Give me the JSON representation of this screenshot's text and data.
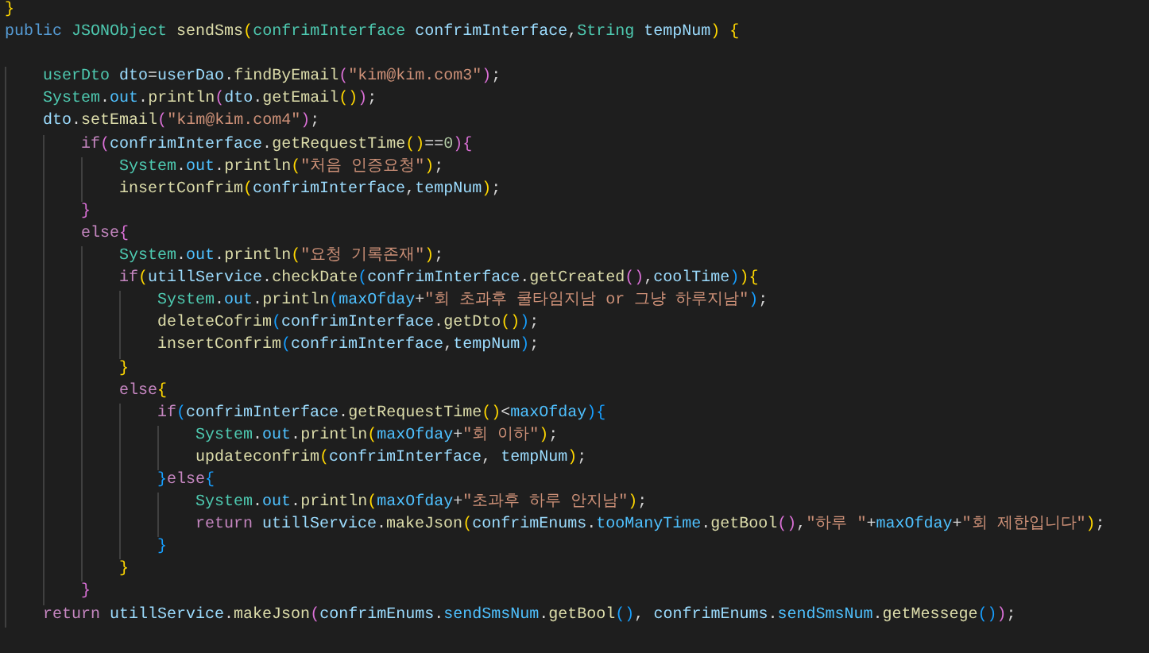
{
  "editor": {
    "lines": [
      {
        "kind": "code",
        "tokens": [
          {
            "kind": "b1",
            "text": "}"
          }
        ]
      },
      {
        "kind": "code",
        "tokens": [
          {
            "kind": "kw",
            "text": "public"
          },
          {
            "kind": "type",
            "text": " JSONObject"
          },
          {
            "kind": "fn",
            "text": " sendSms"
          },
          {
            "kind": "b1",
            "text": "("
          },
          {
            "kind": "type",
            "text": "confrimInterface"
          },
          {
            "kind": "var",
            "text": " confrimInterface"
          },
          {
            "kind": "p",
            "text": ","
          },
          {
            "kind": "type",
            "text": "String"
          },
          {
            "kind": "var",
            "text": " tempNum"
          },
          {
            "kind": "b1",
            "text": ")"
          },
          {
            "kind": "b1",
            "text": " {"
          }
        ]
      },
      {
        "kind": "blank"
      },
      {
        "kind": "code",
        "tokens": [
          {
            "kind": "type",
            "text": "    userDto"
          },
          {
            "kind": "var",
            "text": " dto"
          },
          {
            "kind": "p",
            "text": "="
          },
          {
            "kind": "var",
            "text": "userDao"
          },
          {
            "kind": "p",
            "text": "."
          },
          {
            "kind": "fn",
            "text": "findByEmail"
          },
          {
            "kind": "b2",
            "text": "("
          },
          {
            "kind": "str",
            "text": "\"kim@kim.com3\""
          },
          {
            "kind": "b2",
            "text": ")"
          },
          {
            "kind": "p",
            "text": ";"
          }
        ]
      },
      {
        "kind": "code",
        "tokens": [
          {
            "kind": "type",
            "text": "    System"
          },
          {
            "kind": "p",
            "text": "."
          },
          {
            "kind": "const",
            "text": "out"
          },
          {
            "kind": "p",
            "text": "."
          },
          {
            "kind": "fn",
            "text": "println"
          },
          {
            "kind": "b2",
            "text": "("
          },
          {
            "kind": "var",
            "text": "dto"
          },
          {
            "kind": "p",
            "text": "."
          },
          {
            "kind": "fn",
            "text": "getEmail"
          },
          {
            "kind": "b1",
            "text": "()"
          },
          {
            "kind": "b2",
            "text": ")"
          },
          {
            "kind": "p",
            "text": ";"
          }
        ]
      },
      {
        "kind": "code",
        "tokens": [
          {
            "kind": "var",
            "text": "    dto"
          },
          {
            "kind": "p",
            "text": "."
          },
          {
            "kind": "fn",
            "text": "setEmail"
          },
          {
            "kind": "b2",
            "text": "("
          },
          {
            "kind": "str",
            "text": "\"kim@kim.com4\""
          },
          {
            "kind": "b2",
            "text": ")"
          },
          {
            "kind": "p",
            "text": ";"
          }
        ]
      },
      {
        "kind": "code",
        "tokens": [
          {
            "kind": "ctl",
            "text": "        if"
          },
          {
            "kind": "b2",
            "text": "("
          },
          {
            "kind": "var",
            "text": "confrimInterface"
          },
          {
            "kind": "p",
            "text": "."
          },
          {
            "kind": "fn",
            "text": "getRequestTime"
          },
          {
            "kind": "b1",
            "text": "()"
          },
          {
            "kind": "p",
            "text": "=="
          },
          {
            "kind": "num",
            "text": "0"
          },
          {
            "kind": "b2",
            "text": ")"
          },
          {
            "kind": "b2",
            "text": "{"
          }
        ]
      },
      {
        "kind": "code",
        "tokens": [
          {
            "kind": "type",
            "text": "            System"
          },
          {
            "kind": "p",
            "text": "."
          },
          {
            "kind": "const",
            "text": "out"
          },
          {
            "kind": "p",
            "text": "."
          },
          {
            "kind": "fn",
            "text": "println"
          },
          {
            "kind": "b1",
            "text": "("
          },
          {
            "kind": "str",
            "text": "\"처음 인증요청\""
          },
          {
            "kind": "b1",
            "text": ")"
          },
          {
            "kind": "p",
            "text": ";"
          }
        ]
      },
      {
        "kind": "code",
        "tokens": [
          {
            "kind": "fn",
            "text": "            insertConfrim"
          },
          {
            "kind": "b1",
            "text": "("
          },
          {
            "kind": "var",
            "text": "confrimInterface"
          },
          {
            "kind": "p",
            "text": ","
          },
          {
            "kind": "var",
            "text": "tempNum"
          },
          {
            "kind": "b1",
            "text": ")"
          },
          {
            "kind": "p",
            "text": ";"
          }
        ]
      },
      {
        "kind": "code",
        "tokens": [
          {
            "kind": "b2",
            "text": "        }"
          }
        ]
      },
      {
        "kind": "code",
        "tokens": [
          {
            "kind": "ctl",
            "text": "        else"
          },
          {
            "kind": "b2",
            "text": "{"
          }
        ]
      },
      {
        "kind": "code",
        "tokens": [
          {
            "kind": "type",
            "text": "            System"
          },
          {
            "kind": "p",
            "text": "."
          },
          {
            "kind": "const",
            "text": "out"
          },
          {
            "kind": "p",
            "text": "."
          },
          {
            "kind": "fn",
            "text": "println"
          },
          {
            "kind": "b1",
            "text": "("
          },
          {
            "kind": "str",
            "text": "\"요청 기록존재\""
          },
          {
            "kind": "b1",
            "text": ")"
          },
          {
            "kind": "p",
            "text": ";"
          }
        ]
      },
      {
        "kind": "code",
        "tokens": [
          {
            "kind": "ctl",
            "text": "            if"
          },
          {
            "kind": "b1",
            "text": "("
          },
          {
            "kind": "var",
            "text": "utillService"
          },
          {
            "kind": "p",
            "text": "."
          },
          {
            "kind": "fn",
            "text": "checkDate"
          },
          {
            "kind": "b3",
            "text": "("
          },
          {
            "kind": "var",
            "text": "confrimInterface"
          },
          {
            "kind": "p",
            "text": "."
          },
          {
            "kind": "fn",
            "text": "getCreated"
          },
          {
            "kind": "b2",
            "text": "()"
          },
          {
            "kind": "p",
            "text": ","
          },
          {
            "kind": "var",
            "text": "coolTime"
          },
          {
            "kind": "b3",
            "text": ")"
          },
          {
            "kind": "b1",
            "text": ")"
          },
          {
            "kind": "b1",
            "text": "{"
          }
        ]
      },
      {
        "kind": "code",
        "tokens": [
          {
            "kind": "type",
            "text": "                System"
          },
          {
            "kind": "p",
            "text": "."
          },
          {
            "kind": "const",
            "text": "out"
          },
          {
            "kind": "p",
            "text": "."
          },
          {
            "kind": "fn",
            "text": "println"
          },
          {
            "kind": "b3",
            "text": "("
          },
          {
            "kind": "const",
            "text": "maxOfday"
          },
          {
            "kind": "p",
            "text": "+"
          },
          {
            "kind": "str",
            "text": "\"회 초과후 쿨타임지남 or 그냥 하루지남\""
          },
          {
            "kind": "b3",
            "text": ")"
          },
          {
            "kind": "p",
            "text": ";"
          }
        ]
      },
      {
        "kind": "code",
        "tokens": [
          {
            "kind": "fn",
            "text": "                deleteCofrim"
          },
          {
            "kind": "b3",
            "text": "("
          },
          {
            "kind": "var",
            "text": "confrimInterface"
          },
          {
            "kind": "p",
            "text": "."
          },
          {
            "kind": "fn",
            "text": "getDto"
          },
          {
            "kind": "b1",
            "text": "()"
          },
          {
            "kind": "b3",
            "text": ")"
          },
          {
            "kind": "p",
            "text": ";"
          }
        ]
      },
      {
        "kind": "code",
        "tokens": [
          {
            "kind": "fn",
            "text": "                insertConfrim"
          },
          {
            "kind": "b3",
            "text": "("
          },
          {
            "kind": "var",
            "text": "confrimInterface"
          },
          {
            "kind": "p",
            "text": ","
          },
          {
            "kind": "var",
            "text": "tempNum"
          },
          {
            "kind": "b3",
            "text": ")"
          },
          {
            "kind": "p",
            "text": ";"
          }
        ]
      },
      {
        "kind": "code",
        "tokens": [
          {
            "kind": "b1",
            "text": "            }"
          }
        ]
      },
      {
        "kind": "code",
        "tokens": [
          {
            "kind": "ctl",
            "text": "            else"
          },
          {
            "kind": "b1",
            "text": "{"
          }
        ]
      },
      {
        "kind": "code",
        "tokens": [
          {
            "kind": "ctl",
            "text": "                if"
          },
          {
            "kind": "b3",
            "text": "("
          },
          {
            "kind": "var",
            "text": "confrimInterface"
          },
          {
            "kind": "p",
            "text": "."
          },
          {
            "kind": "fn",
            "text": "getRequestTime"
          },
          {
            "kind": "b1",
            "text": "()"
          },
          {
            "kind": "p",
            "text": "<"
          },
          {
            "kind": "const",
            "text": "maxOfday"
          },
          {
            "kind": "b3",
            "text": ")"
          },
          {
            "kind": "b3",
            "text": "{"
          }
        ]
      },
      {
        "kind": "code",
        "tokens": [
          {
            "kind": "type",
            "text": "                    System"
          },
          {
            "kind": "p",
            "text": "."
          },
          {
            "kind": "const",
            "text": "out"
          },
          {
            "kind": "p",
            "text": "."
          },
          {
            "kind": "fn",
            "text": "println"
          },
          {
            "kind": "b1",
            "text": "("
          },
          {
            "kind": "const",
            "text": "maxOfday"
          },
          {
            "kind": "p",
            "text": "+"
          },
          {
            "kind": "str",
            "text": "\"회 이하\""
          },
          {
            "kind": "b1",
            "text": ")"
          },
          {
            "kind": "p",
            "text": ";"
          }
        ]
      },
      {
        "kind": "code",
        "tokens": [
          {
            "kind": "fn",
            "text": "                    updateconfrim"
          },
          {
            "kind": "b1",
            "text": "("
          },
          {
            "kind": "var",
            "text": "confrimInterface"
          },
          {
            "kind": "p",
            "text": ","
          },
          {
            "kind": "var",
            "text": " tempNum"
          },
          {
            "kind": "b1",
            "text": ")"
          },
          {
            "kind": "p",
            "text": ";"
          }
        ]
      },
      {
        "kind": "code",
        "tokens": [
          {
            "kind": "b3",
            "text": "                }"
          },
          {
            "kind": "ctl",
            "text": "else"
          },
          {
            "kind": "b3",
            "text": "{"
          }
        ]
      },
      {
        "kind": "code",
        "tokens": [
          {
            "kind": "type",
            "text": "                    System"
          },
          {
            "kind": "p",
            "text": "."
          },
          {
            "kind": "const",
            "text": "out"
          },
          {
            "kind": "p",
            "text": "."
          },
          {
            "kind": "fn",
            "text": "println"
          },
          {
            "kind": "b1",
            "text": "("
          },
          {
            "kind": "const",
            "text": "maxOfday"
          },
          {
            "kind": "p",
            "text": "+"
          },
          {
            "kind": "str",
            "text": "\"초과후 하루 안지남\""
          },
          {
            "kind": "b1",
            "text": ")"
          },
          {
            "kind": "p",
            "text": ";"
          }
        ]
      },
      {
        "kind": "code",
        "tokens": [
          {
            "kind": "ctl",
            "text": "                    return"
          },
          {
            "kind": "var",
            "text": " utillService"
          },
          {
            "kind": "p",
            "text": "."
          },
          {
            "kind": "fn",
            "text": "makeJson"
          },
          {
            "kind": "b1",
            "text": "("
          },
          {
            "kind": "var",
            "text": "confrimEnums"
          },
          {
            "kind": "p",
            "text": "."
          },
          {
            "kind": "const",
            "text": "tooManyTime"
          },
          {
            "kind": "p",
            "text": "."
          },
          {
            "kind": "fn",
            "text": "getBool"
          },
          {
            "kind": "b2",
            "text": "()"
          },
          {
            "kind": "p",
            "text": ","
          },
          {
            "kind": "str",
            "text": "\"하루 \""
          },
          {
            "kind": "p",
            "text": "+"
          },
          {
            "kind": "const",
            "text": "maxOfday"
          },
          {
            "kind": "p",
            "text": "+"
          },
          {
            "kind": "str",
            "text": "\"회 제한입니다\""
          },
          {
            "kind": "b1",
            "text": ")"
          },
          {
            "kind": "p",
            "text": ";"
          }
        ]
      },
      {
        "kind": "code",
        "tokens": [
          {
            "kind": "b3",
            "text": "                }"
          }
        ]
      },
      {
        "kind": "code",
        "tokens": [
          {
            "kind": "b1",
            "text": "            }"
          }
        ]
      },
      {
        "kind": "code",
        "tokens": [
          {
            "kind": "b2",
            "text": "        }"
          }
        ]
      },
      {
        "kind": "code",
        "tokens": [
          {
            "kind": "ctl",
            "text": "    return"
          },
          {
            "kind": "var",
            "text": " utillService"
          },
          {
            "kind": "p",
            "text": "."
          },
          {
            "kind": "fn",
            "text": "makeJson"
          },
          {
            "kind": "b2",
            "text": "("
          },
          {
            "kind": "var",
            "text": "confrimEnums"
          },
          {
            "kind": "p",
            "text": "."
          },
          {
            "kind": "const",
            "text": "sendSmsNum"
          },
          {
            "kind": "p",
            "text": "."
          },
          {
            "kind": "fn",
            "text": "getBool"
          },
          {
            "kind": "b3",
            "text": "()"
          },
          {
            "kind": "p",
            "text": ","
          },
          {
            "kind": "var",
            "text": " confrimEnums"
          },
          {
            "kind": "p",
            "text": "."
          },
          {
            "kind": "const",
            "text": "sendSmsNum"
          },
          {
            "kind": "p",
            "text": "."
          },
          {
            "kind": "fn",
            "text": "getMessege"
          },
          {
            "kind": "b3",
            "text": "()"
          },
          {
            "kind": "b2",
            "text": ")"
          },
          {
            "kind": "p",
            "text": ";"
          }
        ]
      }
    ]
  }
}
